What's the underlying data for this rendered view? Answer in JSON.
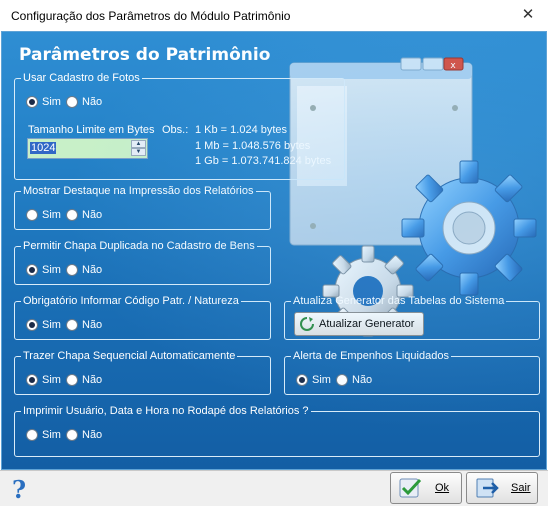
{
  "window": {
    "title": "Configuração dos Parâmetros do Módulo Patrimônio",
    "close_symbol": "✕"
  },
  "heading": "Parâmetros do Patrimônio",
  "radio_labels": {
    "yes": "Sim",
    "no": "Não"
  },
  "groups": {
    "usar_fotos": {
      "label": "Usar Cadastro de Fotos",
      "selected": "Sim"
    },
    "destaque": {
      "label": "Mostrar Destaque na Impressão dos Relatórios",
      "selected": "none"
    },
    "chapa_duplicada": {
      "label": "Permitir Chapa Duplicada no Cadastro de Bens",
      "selected": "Sim"
    },
    "codigo_patr": {
      "label": "Obrigatório Informar Código Patr. / Natureza",
      "selected": "Sim"
    },
    "chapa_seq": {
      "label": "Trazer Chapa Sequencial Automaticamente",
      "selected": "Sim"
    },
    "rodape": {
      "label": "Imprimir Usuário, Data e Hora no Rodapé dos Relatórios ?",
      "selected": "none"
    },
    "generator": {
      "label": "Atualiza Generator das Tabelas do Sistema",
      "button": "Atualizar Generator"
    },
    "empenhos": {
      "label": "Alerta de Empenhos Liquidados",
      "selected": "Sim"
    }
  },
  "size_limit": {
    "label": "Tamanho Limite em Bytes",
    "value": "1024",
    "obs": "Obs.:",
    "kb": "1 Kb = 1.024 bytes",
    "mb": "1 Mb = 1.048.576 bytes",
    "gb": "1 Gb = 1.073.741.824 bytes"
  },
  "footer": {
    "help": "?",
    "ok": "Ok",
    "exit": "Sair"
  },
  "icons": [
    "close-icon",
    "gears-illustration",
    "help-icon",
    "ok-check-icon",
    "exit-door-icon",
    "refresh-icon"
  ]
}
